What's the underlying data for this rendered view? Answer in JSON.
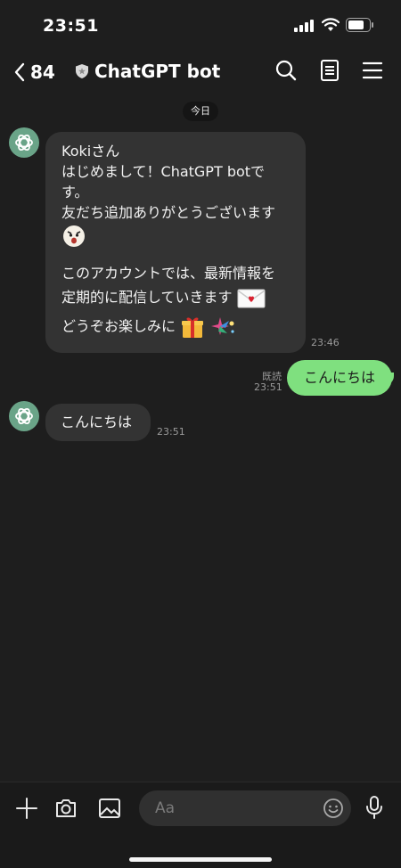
{
  "status_bar": {
    "time": "23:51"
  },
  "header": {
    "back_count": "84",
    "title": "ChatGPT bot"
  },
  "date_chip": "今日",
  "messages": [
    {
      "lines": [
        "Kokiさん",
        "はじめまして！ChatGPT botで",
        "す。",
        "友だち追加ありがとうございます",
        "",
        "このアカウントでは、最新情報を",
        "定期的に配信していきます",
        "どうぞお楽しみに"
      ],
      "time": "23:46"
    },
    {
      "text": "こんにちは",
      "read": "既読",
      "time": "23:51"
    },
    {
      "text": "こんにちは",
      "time": "23:51"
    }
  ],
  "composer": {
    "placeholder": "Aa"
  },
  "colors": {
    "background": "#1e1e1e",
    "bubble_in": "#333333",
    "bubble_out": "#7fe07f",
    "avatar": "#6aa488"
  },
  "icons": [
    "back-chevron-icon",
    "shield-icon",
    "search-icon",
    "notes-icon",
    "menu-icon",
    "plus-icon",
    "camera-icon",
    "image-icon",
    "emoji-icon",
    "mic-icon",
    "openai-logo-icon"
  ]
}
